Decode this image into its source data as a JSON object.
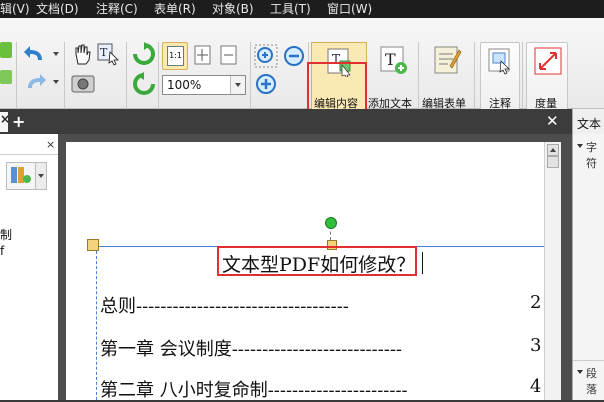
{
  "menu": [
    "辑(V)",
    "文档(D)",
    "注释(C)",
    "表单(R)",
    "对象(B)",
    "工具(T)",
    "窗口(W)"
  ],
  "toolbar": {
    "zoom_value": "100%",
    "edit_content": "编辑内容",
    "add_text": "添加文本",
    "edit_form": "编辑表单",
    "annotate": "注释",
    "measure": "度量",
    "fit_label": "1:1"
  },
  "tabs": {
    "right_tab": "文本"
  },
  "left_panel": {
    "text1": "制",
    "text2": "f"
  },
  "right_panel": {
    "section1": "字符",
    "section2": "段落"
  },
  "document": {
    "title": "文本型PDF如何修改？",
    "lines": [
      {
        "text": "总则-----------------------------------",
        "page": "2"
      },
      {
        "text": "第一章  会议制度----------------------------",
        "page": "3"
      },
      {
        "text": "第二章  八小时复命制-----------------------",
        "page": "4"
      }
    ]
  },
  "colors": {
    "highlight": "#e03030",
    "selection_box": "#4a7fd6",
    "handle": "#f2d27a",
    "rotate_handle": "#2fbf3a"
  }
}
